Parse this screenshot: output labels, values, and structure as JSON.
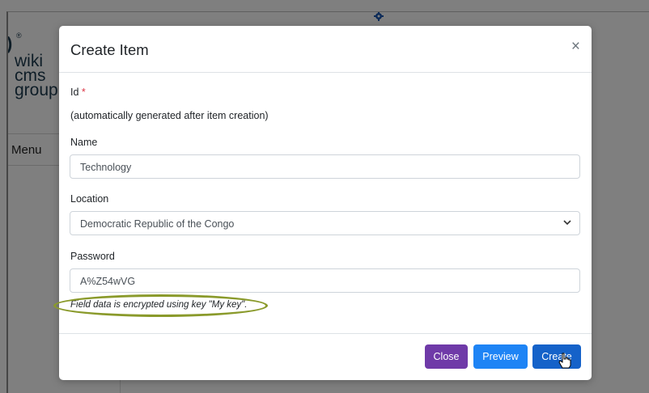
{
  "background": {
    "logo": {
      "mark": ")",
      "registered": "®",
      "line1": "wiki",
      "line2": "cms",
      "line3": "group"
    },
    "menu_label": "Menu",
    "gear_icon": "gear-icon"
  },
  "modal": {
    "title": "Create Item",
    "close_symbol": "×",
    "id_field": {
      "label": "Id",
      "required_mark": "*",
      "hint": "(automatically generated after item creation)"
    },
    "name_field": {
      "label": "Name",
      "value": "Technology"
    },
    "location_field": {
      "label": "Location",
      "selected": "Democratic Republic of the Congo",
      "arrow": "⌄"
    },
    "password_field": {
      "label": "Password",
      "value": "A%Z54wVG",
      "note": "Field data is encrypted using key \"My key\"."
    },
    "buttons": {
      "close": "Close",
      "preview": "Preview",
      "create": "Create"
    },
    "cursor_icon": "hand-pointer-icon"
  },
  "colors": {
    "close_btn": "#6f3aa8",
    "preview_btn": "#1e84f5",
    "create_btn": "#1562c9",
    "required": "#dc3545",
    "highlight": "#8a9a2b"
  }
}
